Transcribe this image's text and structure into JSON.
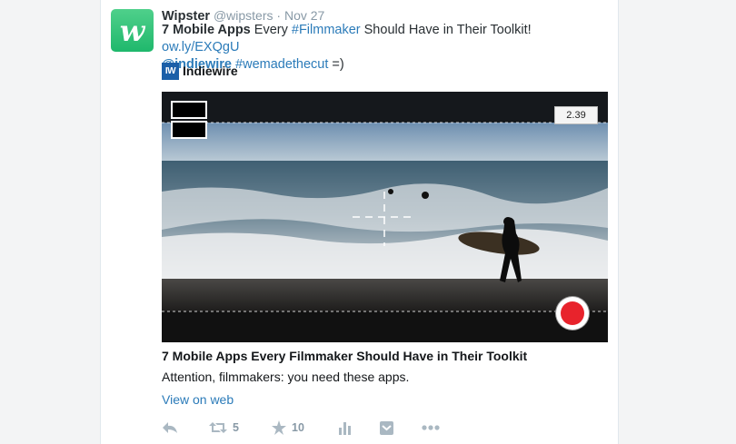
{
  "tweet": {
    "author_name": "Wipster",
    "author_handle": "@wipsters",
    "separator": "·",
    "timestamp": "Nov 27",
    "avatar_letter": "w",
    "text_bold": "7 Mobile Apps",
    "text_part1": " Every ",
    "hashtag1": "#Filmmaker",
    "text_part2": " Should Have in Their Toolkit! ",
    "url": "ow.ly/EXQgU",
    "mention": "@indiewire",
    "hashtag2": "#wemadethecut",
    "text_end": " =)"
  },
  "source": {
    "logo_text": "IW",
    "name": "Indiewire"
  },
  "media": {
    "timer": "2.39"
  },
  "card": {
    "title": "7 Mobile Apps Every Filmmaker Should Have in Their Toolkit",
    "description": "Attention, filmmakers: you need these apps.",
    "view_web": "View on web"
  },
  "actions": {
    "retweet_count": "5",
    "favorite_count": "10"
  },
  "icons": [
    "reply-icon",
    "retweet-icon",
    "favorite-star-icon",
    "analytics-icon",
    "embed-icon",
    "more-icon"
  ],
  "colors": {
    "link": "#2b7bb9",
    "avatar_green": "#1fb86c",
    "record_red": "#e8232c",
    "icon_grey": "#aab8c2"
  }
}
